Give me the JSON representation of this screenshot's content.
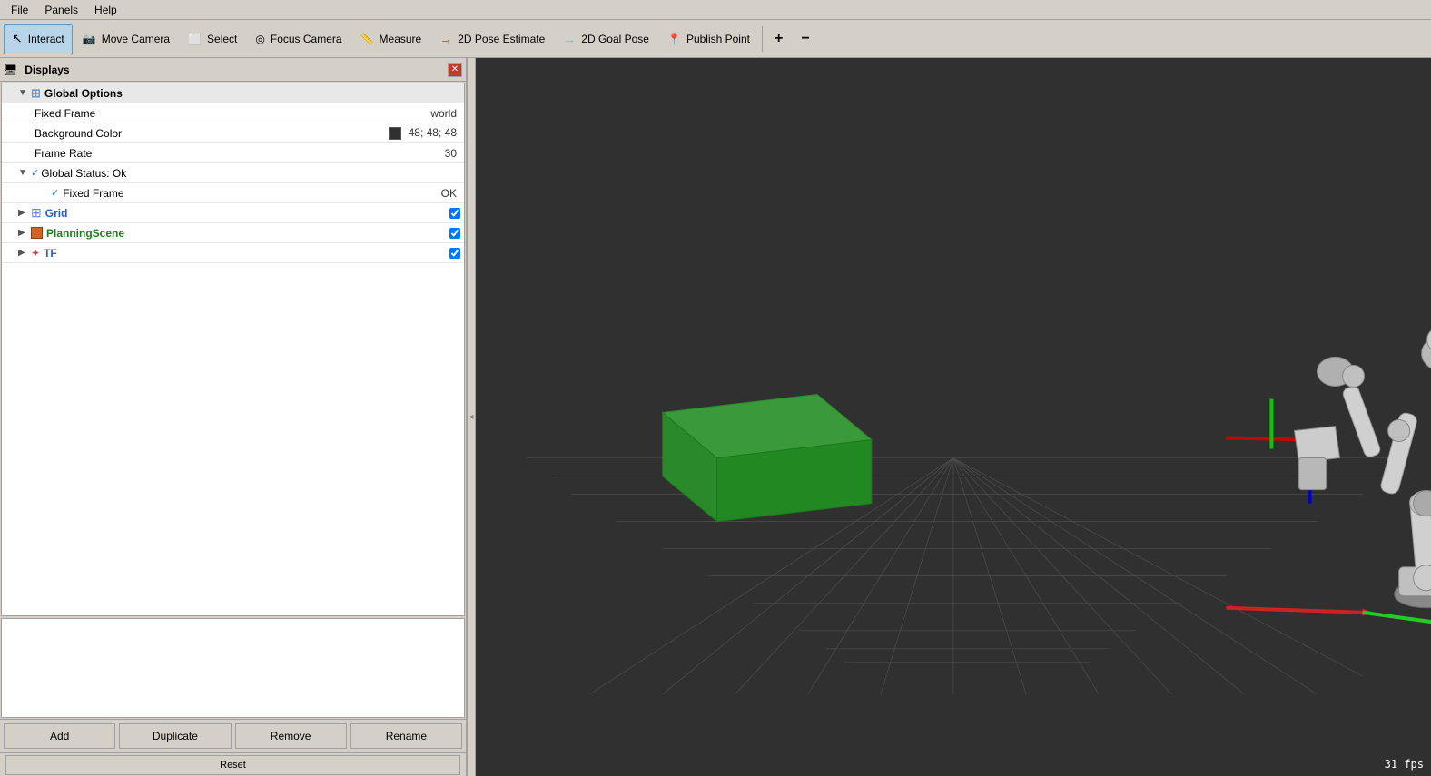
{
  "menubar": {
    "items": [
      "File",
      "Panels",
      "Help"
    ]
  },
  "toolbar": {
    "buttons": [
      {
        "id": "interact",
        "label": "Interact",
        "icon": "interact-icon",
        "active": true
      },
      {
        "id": "move-camera",
        "label": "Move Camera",
        "icon": "camera-icon",
        "active": false
      },
      {
        "id": "select",
        "label": "Select",
        "icon": "select-icon",
        "active": false
      },
      {
        "id": "focus-camera",
        "label": "Focus Camera",
        "icon": "focus-icon",
        "active": false
      },
      {
        "id": "measure",
        "label": "Measure",
        "icon": "measure-icon",
        "active": false
      },
      {
        "id": "2d-pose",
        "label": "2D Pose Estimate",
        "icon": "pose2d-icon",
        "active": false
      },
      {
        "id": "2d-goal",
        "label": "2D Goal Pose",
        "icon": "goal2d-icon",
        "active": false
      },
      {
        "id": "publish-point",
        "label": "Publish Point",
        "icon": "publish-icon",
        "active": false
      }
    ],
    "plus_label": "+",
    "minus_label": "−"
  },
  "left_panel": {
    "title": "Displays",
    "tree": {
      "global_options": {
        "label": "Global Options",
        "fixed_frame_label": "Fixed Frame",
        "fixed_frame_value": "world",
        "background_color_label": "Background Color",
        "background_color_value": "48; 48; 48",
        "frame_rate_label": "Frame Rate",
        "frame_rate_value": "30"
      },
      "global_status": {
        "label": "Global Status: Ok",
        "fixed_frame_label": "Fixed Frame",
        "fixed_frame_value": "OK"
      },
      "items": [
        {
          "id": "grid",
          "label": "Grid",
          "icon": "grid-display-icon",
          "checked": true
        },
        {
          "id": "planning-scene",
          "label": "PlanningScene",
          "icon": "planning-icon",
          "checked": true
        },
        {
          "id": "tf",
          "label": "TF",
          "icon": "tf-icon",
          "checked": true
        }
      ]
    },
    "buttons": {
      "add": "Add",
      "duplicate": "Duplicate",
      "remove": "Remove",
      "rename": "Rename"
    },
    "statusbar": {
      "reset_label": "Reset"
    }
  },
  "viewport": {
    "fps_label": "31 fps"
  }
}
